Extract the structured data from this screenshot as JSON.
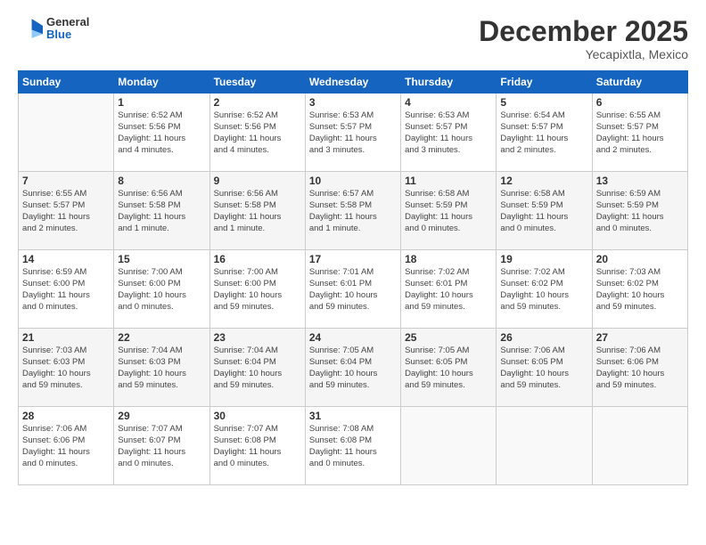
{
  "header": {
    "logo_general": "General",
    "logo_blue": "Blue",
    "month_title": "December 2025",
    "location": "Yecapixtla, Mexico"
  },
  "days_of_week": [
    "Sunday",
    "Monday",
    "Tuesday",
    "Wednesday",
    "Thursday",
    "Friday",
    "Saturday"
  ],
  "weeks": [
    [
      {
        "day": "",
        "info": ""
      },
      {
        "day": "1",
        "info": "Sunrise: 6:52 AM\nSunset: 5:56 PM\nDaylight: 11 hours\nand 4 minutes."
      },
      {
        "day": "2",
        "info": "Sunrise: 6:52 AM\nSunset: 5:56 PM\nDaylight: 11 hours\nand 4 minutes."
      },
      {
        "day": "3",
        "info": "Sunrise: 6:53 AM\nSunset: 5:57 PM\nDaylight: 11 hours\nand 3 minutes."
      },
      {
        "day": "4",
        "info": "Sunrise: 6:53 AM\nSunset: 5:57 PM\nDaylight: 11 hours\nand 3 minutes."
      },
      {
        "day": "5",
        "info": "Sunrise: 6:54 AM\nSunset: 5:57 PM\nDaylight: 11 hours\nand 2 minutes."
      },
      {
        "day": "6",
        "info": "Sunrise: 6:55 AM\nSunset: 5:57 PM\nDaylight: 11 hours\nand 2 minutes."
      }
    ],
    [
      {
        "day": "7",
        "info": "Sunrise: 6:55 AM\nSunset: 5:57 PM\nDaylight: 11 hours\nand 2 minutes."
      },
      {
        "day": "8",
        "info": "Sunrise: 6:56 AM\nSunset: 5:58 PM\nDaylight: 11 hours\nand 1 minute."
      },
      {
        "day": "9",
        "info": "Sunrise: 6:56 AM\nSunset: 5:58 PM\nDaylight: 11 hours\nand 1 minute."
      },
      {
        "day": "10",
        "info": "Sunrise: 6:57 AM\nSunset: 5:58 PM\nDaylight: 11 hours\nand 1 minute."
      },
      {
        "day": "11",
        "info": "Sunrise: 6:58 AM\nSunset: 5:59 PM\nDaylight: 11 hours\nand 0 minutes."
      },
      {
        "day": "12",
        "info": "Sunrise: 6:58 AM\nSunset: 5:59 PM\nDaylight: 11 hours\nand 0 minutes."
      },
      {
        "day": "13",
        "info": "Sunrise: 6:59 AM\nSunset: 5:59 PM\nDaylight: 11 hours\nand 0 minutes."
      }
    ],
    [
      {
        "day": "14",
        "info": "Sunrise: 6:59 AM\nSunset: 6:00 PM\nDaylight: 11 hours\nand 0 minutes."
      },
      {
        "day": "15",
        "info": "Sunrise: 7:00 AM\nSunset: 6:00 PM\nDaylight: 10 hours\nand 0 minutes."
      },
      {
        "day": "16",
        "info": "Sunrise: 7:00 AM\nSunset: 6:00 PM\nDaylight: 10 hours\nand 59 minutes."
      },
      {
        "day": "17",
        "info": "Sunrise: 7:01 AM\nSunset: 6:01 PM\nDaylight: 10 hours\nand 59 minutes."
      },
      {
        "day": "18",
        "info": "Sunrise: 7:02 AM\nSunset: 6:01 PM\nDaylight: 10 hours\nand 59 minutes."
      },
      {
        "day": "19",
        "info": "Sunrise: 7:02 AM\nSunset: 6:02 PM\nDaylight: 10 hours\nand 59 minutes."
      },
      {
        "day": "20",
        "info": "Sunrise: 7:03 AM\nSunset: 6:02 PM\nDaylight: 10 hours\nand 59 minutes."
      }
    ],
    [
      {
        "day": "21",
        "info": "Sunrise: 7:03 AM\nSunset: 6:03 PM\nDaylight: 10 hours\nand 59 minutes."
      },
      {
        "day": "22",
        "info": "Sunrise: 7:04 AM\nSunset: 6:03 PM\nDaylight: 10 hours\nand 59 minutes."
      },
      {
        "day": "23",
        "info": "Sunrise: 7:04 AM\nSunset: 6:04 PM\nDaylight: 10 hours\nand 59 minutes."
      },
      {
        "day": "24",
        "info": "Sunrise: 7:05 AM\nSunset: 6:04 PM\nDaylight: 10 hours\nand 59 minutes."
      },
      {
        "day": "25",
        "info": "Sunrise: 7:05 AM\nSunset: 6:05 PM\nDaylight: 10 hours\nand 59 minutes."
      },
      {
        "day": "26",
        "info": "Sunrise: 7:06 AM\nSunset: 6:05 PM\nDaylight: 10 hours\nand 59 minutes."
      },
      {
        "day": "27",
        "info": "Sunrise: 7:06 AM\nSunset: 6:06 PM\nDaylight: 10 hours\nand 59 minutes."
      }
    ],
    [
      {
        "day": "28",
        "info": "Sunrise: 7:06 AM\nSunset: 6:06 PM\nDaylight: 11 hours\nand 0 minutes."
      },
      {
        "day": "29",
        "info": "Sunrise: 7:07 AM\nSunset: 6:07 PM\nDaylight: 11 hours\nand 0 minutes."
      },
      {
        "day": "30",
        "info": "Sunrise: 7:07 AM\nSunset: 6:08 PM\nDaylight: 11 hours\nand 0 minutes."
      },
      {
        "day": "31",
        "info": "Sunrise: 7:08 AM\nSunset: 6:08 PM\nDaylight: 11 hours\nand 0 minutes."
      },
      {
        "day": "",
        "info": ""
      },
      {
        "day": "",
        "info": ""
      },
      {
        "day": "",
        "info": ""
      }
    ]
  ]
}
